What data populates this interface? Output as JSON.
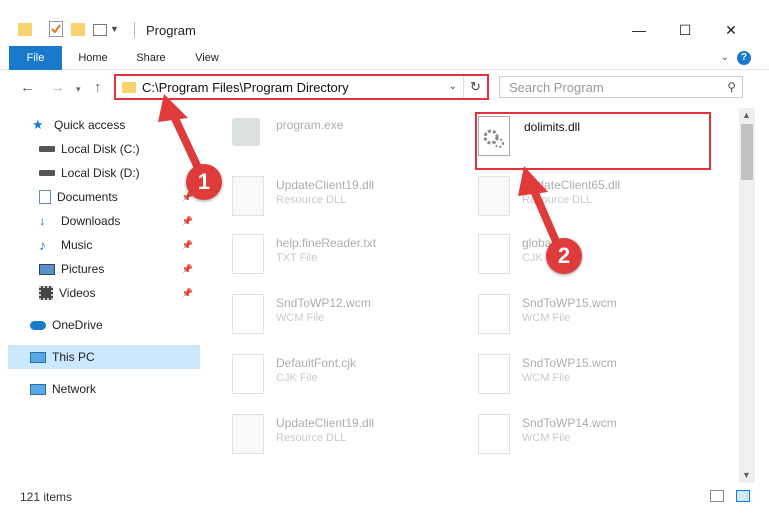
{
  "window": {
    "title": "Program"
  },
  "ribbon": {
    "tabs": [
      "File",
      "Home",
      "Share",
      "View"
    ]
  },
  "address": {
    "path": "C:\\Program Files\\Program Directory"
  },
  "search": {
    "placeholder": "Search Program"
  },
  "sidebar": {
    "items": [
      {
        "label": "Quick access",
        "icon": "star-icon"
      },
      {
        "label": "Local Disk (C:)",
        "icon": "drive-icon"
      },
      {
        "label": "Local Disk (D:)",
        "icon": "drive-icon"
      },
      {
        "label": "Documents",
        "icon": "documents-icon"
      },
      {
        "label": "Downloads",
        "icon": "download-icon"
      },
      {
        "label": "Music",
        "icon": "music-icon"
      },
      {
        "label": "Pictures",
        "icon": "pictures-icon"
      },
      {
        "label": "Videos",
        "icon": "videos-icon"
      },
      {
        "label": "OneDrive",
        "icon": "cloud-icon"
      },
      {
        "label": "This PC",
        "icon": "pc-icon"
      },
      {
        "label": "Network",
        "icon": "network-icon"
      }
    ]
  },
  "files": [
    {
      "name": "program.exe",
      "type": ""
    },
    {
      "name": "dolimits.dll",
      "type": ""
    },
    {
      "name": "UpdateClient19.dll",
      "type": "Resource DLL"
    },
    {
      "name": "UpdateClient65.dll",
      "type": "Resource DLL"
    },
    {
      "name": "help.fineReader.txt",
      "type": "TXT File"
    },
    {
      "name": "global.cjk",
      "type": "CJK File"
    },
    {
      "name": "SndToWP12.wcm",
      "type": "WCM File"
    },
    {
      "name": "SndToWP15.wcm",
      "type": "WCM File"
    },
    {
      "name": "DefaultFont.cjk",
      "type": "CJK File"
    },
    {
      "name": "SndToWP15.wcm",
      "type": "WCM File"
    },
    {
      "name": "UpdateClient19.dll",
      "type": "Resource DLL"
    },
    {
      "name": "SndToWP14.wcm",
      "type": "WCM File"
    }
  ],
  "status": {
    "count": "121 items"
  },
  "annotations": {
    "step1": "1",
    "step2": "2"
  },
  "colors": {
    "accent": "#1979ca",
    "highlight": "#e2323c",
    "badge": "#e03b3b",
    "selection": "#cce8ff"
  }
}
